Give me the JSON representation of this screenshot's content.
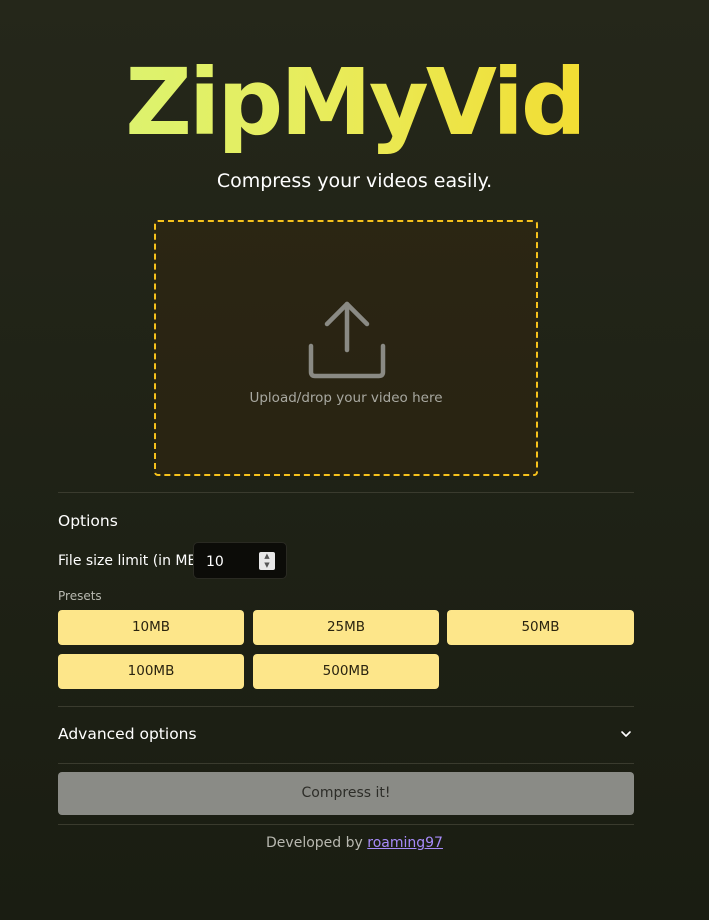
{
  "header": {
    "logo": "ZipMyVid",
    "tagline": "Compress your videos easily."
  },
  "dropzone": {
    "icon": "upload-icon",
    "text": "Upload/drop your video here",
    "border_color": "#f6c21c"
  },
  "options": {
    "title": "Options",
    "file_size_label": "File size limit (in MB)",
    "file_size_value": "10",
    "presets_label": "Presets",
    "presets": [
      "10MB",
      "25MB",
      "50MB",
      "100MB",
      "500MB"
    ],
    "preset_color": "#fde68a"
  },
  "advanced": {
    "label": "Advanced options",
    "icon": "chevron-down-icon"
  },
  "compress": {
    "label": "Compress it!"
  },
  "footer": {
    "prefix": "Developed by",
    "author": "roaming97",
    "link_color": "#a78bfa"
  }
}
